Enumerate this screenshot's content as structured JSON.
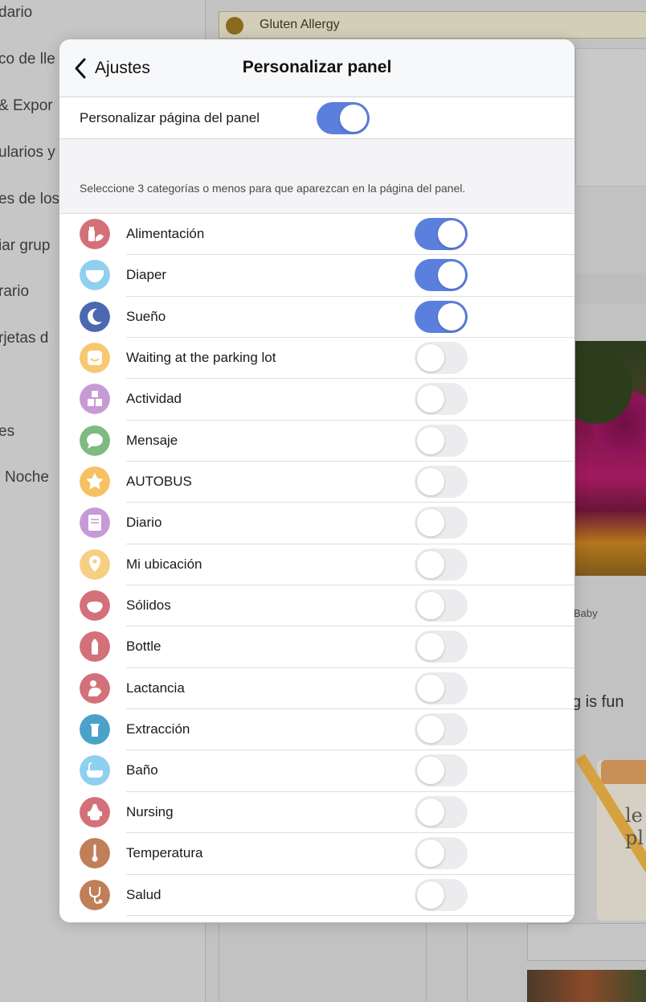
{
  "background": {
    "sidebar_items": [
      "dario",
      "co de lle",
      "& Expor",
      "ularios y",
      "es de los",
      "iar grup",
      "rario",
      "rjetas d",
      "es",
      "Noche"
    ],
    "banner_text": "Gluten Allergy",
    "photo_caption": "Baby",
    "card_text": "g is fun",
    "notebook_text": "le\npl"
  },
  "navbar": {
    "back_label": "Ajustes",
    "title": "Personalizar panel"
  },
  "master": {
    "label": "Personalizar página del panel",
    "enabled": true
  },
  "section_note": "Seleccione 3 categorías o menos para que aparezcan en la página del panel.",
  "colors": {
    "accent": "#5b7fdc",
    "toggle_off": "#ececee"
  },
  "categories": [
    {
      "label": "Alimentación",
      "enabled": true,
      "icon": "feeding-bottle-icon",
      "color": "#d47079"
    },
    {
      "label": "Diaper",
      "enabled": true,
      "icon": "diaper-icon",
      "color": "#8fcff0"
    },
    {
      "label": "Sueño",
      "enabled": true,
      "icon": "moon-sleep-icon",
      "color": "#4b68b0"
    },
    {
      "label": "Waiting at the parking lot",
      "enabled": false,
      "icon": "smiley-icon",
      "color": "#f7c871"
    },
    {
      "label": "Actividad",
      "enabled": false,
      "icon": "blocks-icon",
      "color": "#c79ad6"
    },
    {
      "label": "Mensaje",
      "enabled": false,
      "icon": "speech-bubble-icon",
      "color": "#7fba80"
    },
    {
      "label": "AUTOBUS",
      "enabled": false,
      "icon": "star-icon",
      "color": "#f6c163"
    },
    {
      "label": "Diario",
      "enabled": false,
      "icon": "journal-icon",
      "color": "#c79ad6"
    },
    {
      "label": "Mi ubicación",
      "enabled": false,
      "icon": "location-pin-icon",
      "color": "#f6cf83"
    },
    {
      "label": "Sólidos",
      "enabled": false,
      "icon": "bowl-icon",
      "color": "#d47079"
    },
    {
      "label": "Bottle",
      "enabled": false,
      "icon": "bottle-icon",
      "color": "#d47079"
    },
    {
      "label": "Lactancia",
      "enabled": false,
      "icon": "breastfeeding-icon",
      "color": "#d47079"
    },
    {
      "label": "Extracción",
      "enabled": false,
      "icon": "breast-pump-icon",
      "color": "#4aa2c9"
    },
    {
      "label": "Baño",
      "enabled": false,
      "icon": "bathtub-icon",
      "color": "#8fcff0"
    },
    {
      "label": "Nursing",
      "enabled": false,
      "icon": "sippy-cup-icon",
      "color": "#d47079"
    },
    {
      "label": "Temperatura",
      "enabled": false,
      "icon": "thermometer-icon",
      "color": "#c07f58"
    },
    {
      "label": "Salud",
      "enabled": false,
      "icon": "stethoscope-icon",
      "color": "#c07f58"
    }
  ]
}
